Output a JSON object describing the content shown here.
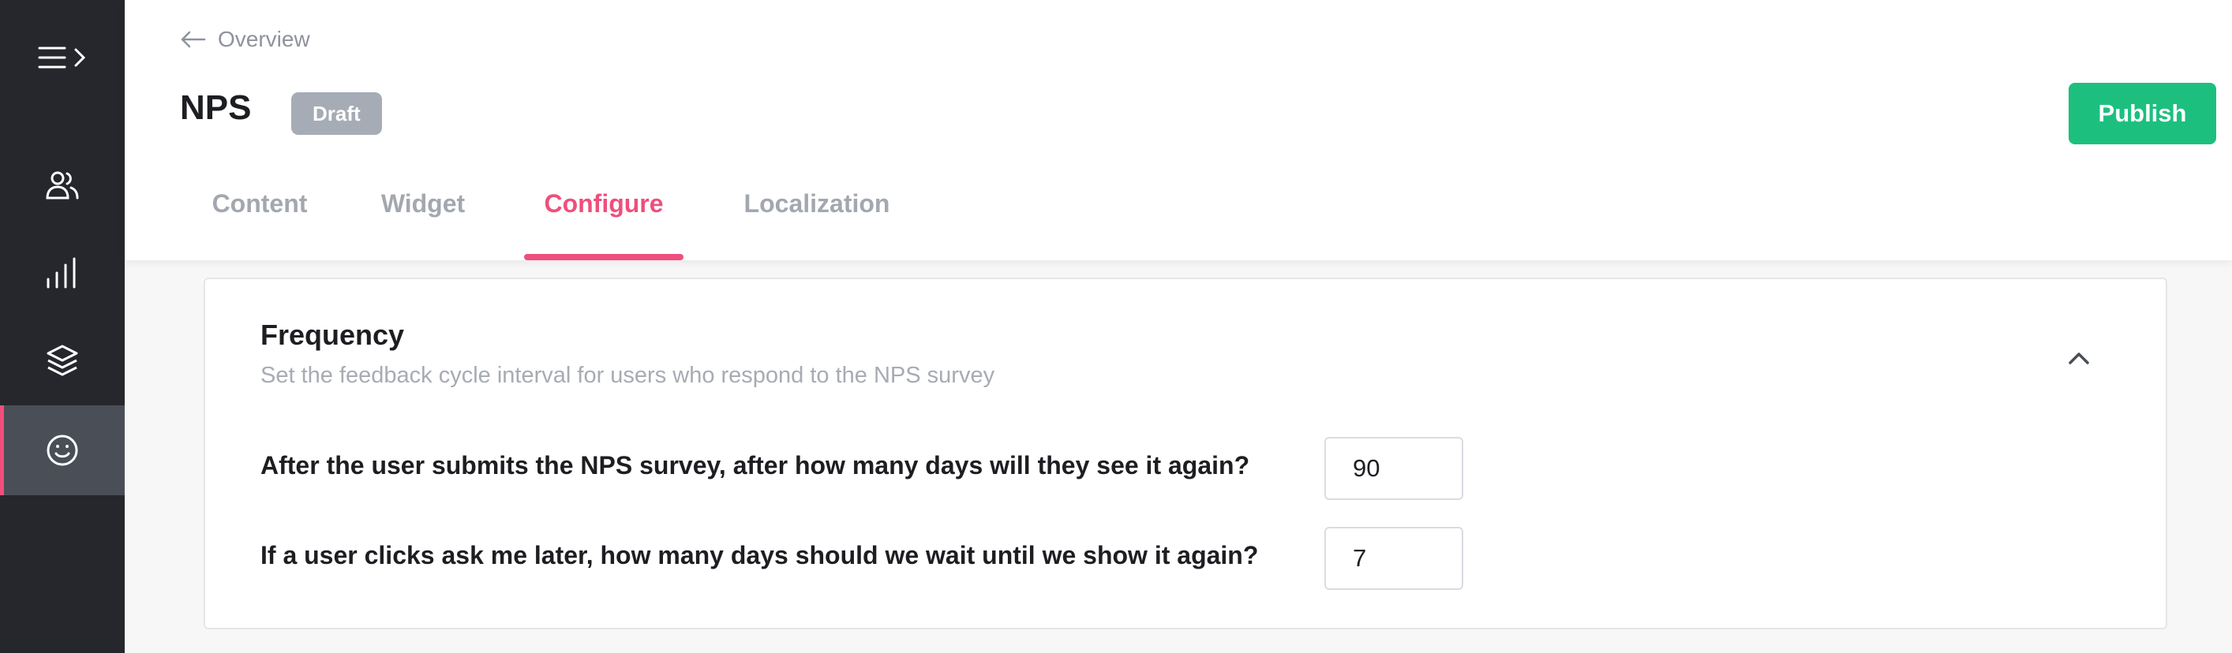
{
  "header": {
    "back_label": "Overview",
    "title": "NPS",
    "status": "Draft",
    "publish_label": "Publish"
  },
  "tabs": [
    {
      "label": "Content",
      "active": false
    },
    {
      "label": "Widget",
      "active": false
    },
    {
      "label": "Configure",
      "active": true
    },
    {
      "label": "Localization",
      "active": false
    }
  ],
  "sidebar": {
    "items": [
      {
        "icon": "menu-expand-icon"
      },
      {
        "icon": "users-icon"
      },
      {
        "icon": "analytics-icon"
      },
      {
        "icon": "layers-icon"
      },
      {
        "icon": "smiley-icon",
        "active": true
      }
    ]
  },
  "frequency": {
    "title": "Frequency",
    "subtitle": "Set the feedback cycle interval for users who respond to the NPS survey",
    "rows": [
      {
        "label": "After the user submits the NPS survey, after how many days will they see it again?",
        "value": "90"
      },
      {
        "label": "If a user clicks ask me later, how many days should we wait until we show it again?",
        "value": "7"
      }
    ]
  },
  "colors": {
    "accent": "#ee4f7c",
    "publish": "#1dbf7f",
    "sidebar": "#25272c",
    "badge": "#a6acb6"
  }
}
